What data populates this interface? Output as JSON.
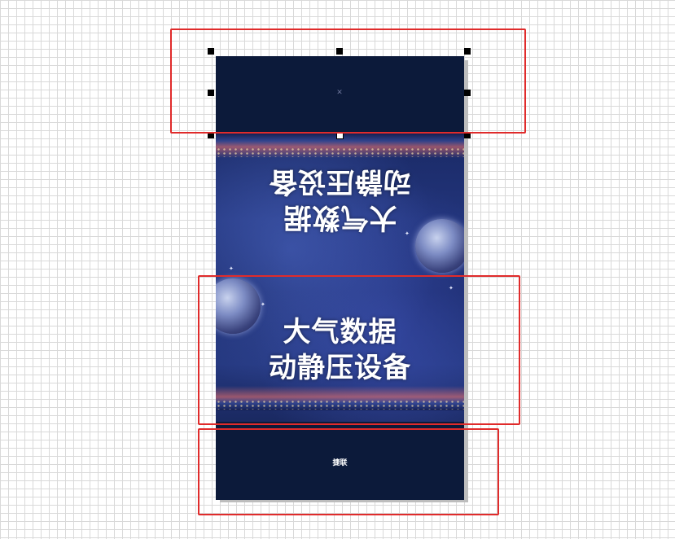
{
  "canvas": {
    "background": "#ffffff",
    "grid_color": "#d9d9d9"
  },
  "document": {
    "background": "#0c1a3a",
    "headline_mirrored": {
      "line1": "大气数据",
      "line2": "动静压设备"
    },
    "headline": {
      "line1": "大气数据",
      "line2": "动静压设备"
    },
    "brand": "捷联",
    "anchor_icon": "x-mark-icon"
  },
  "selection": {
    "handle_color": "#000000",
    "handle_icon": "resize-handle"
  },
  "highlights": {
    "color": "#e02b2b",
    "count": 3
  }
}
